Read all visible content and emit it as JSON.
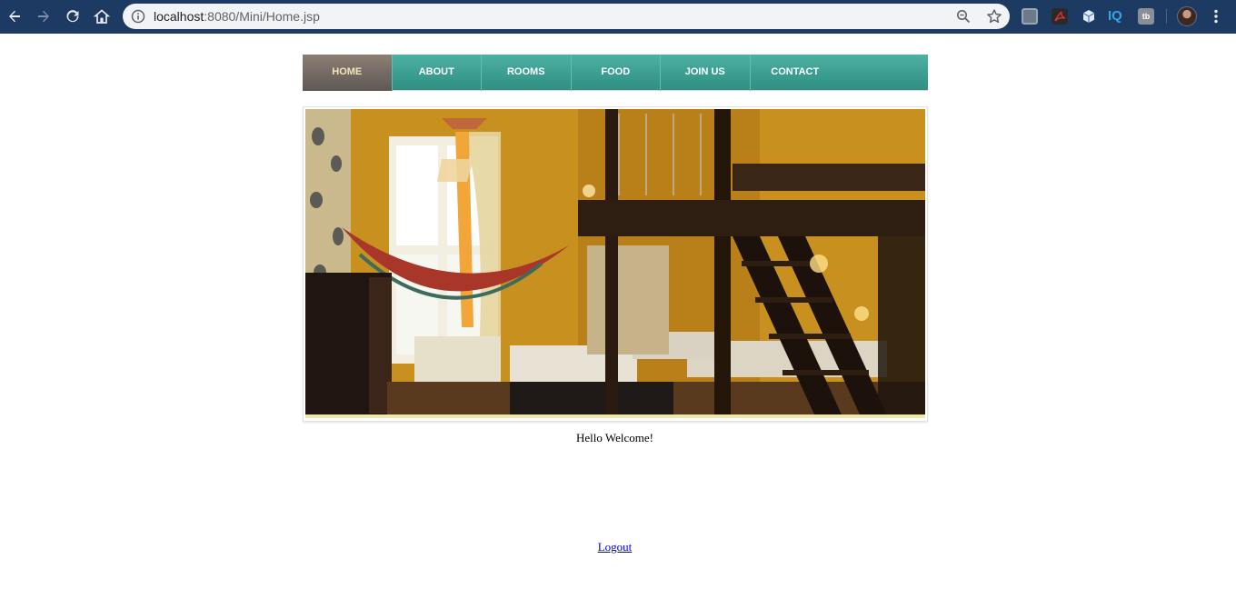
{
  "browser": {
    "url_host": "localhost",
    "url_path": ":8080/Mini/Home.jsp",
    "icons": [
      "back-icon",
      "forward-icon",
      "reload-icon",
      "home-icon",
      "info-icon",
      "zoom-icon",
      "star-icon",
      "menu-icon"
    ],
    "extensions": {
      "iq_label": "IQ",
      "tb_label": "tb"
    }
  },
  "nav": {
    "items": [
      {
        "label": "HOME",
        "active": true
      },
      {
        "label": "ABOUT",
        "active": false
      },
      {
        "label": "ROOMS",
        "active": false
      },
      {
        "label": "FOOD",
        "active": false
      },
      {
        "label": "JOIN US",
        "active": false
      },
      {
        "label": "CONTACT",
        "active": false
      }
    ]
  },
  "hero": {
    "image_name": "hostel-room-photo"
  },
  "welcome_text": "Hello Welcome!",
  "logout_label": "Logout",
  "colors": {
    "chrome_bg": "#1d3a63",
    "nav_teal": "#3a9c8f",
    "nav_active": "#7a6d64",
    "active_text": "#f3e6b8",
    "link": "#0000ee"
  }
}
